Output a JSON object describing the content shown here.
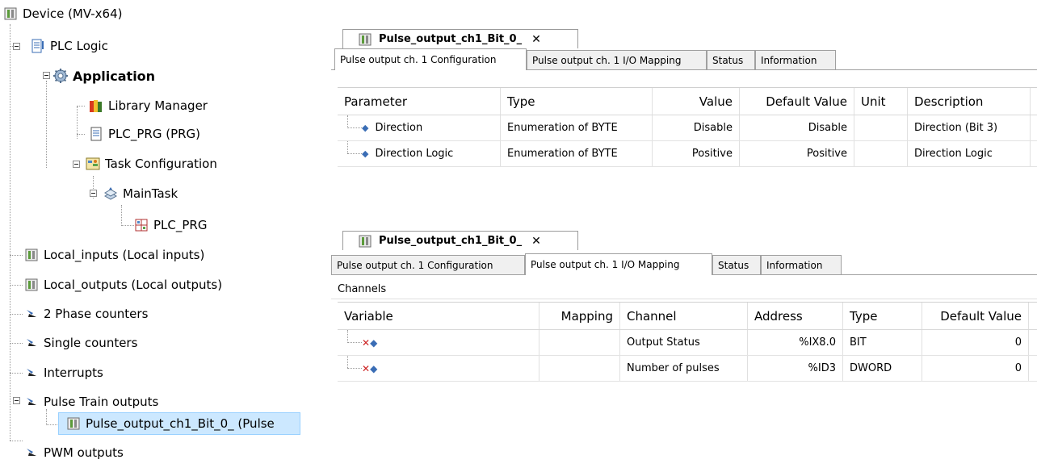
{
  "tree": {
    "device": "Device (MV-x64)",
    "plc_logic": "PLC Logic",
    "application": "Application",
    "library_manager": "Library Manager",
    "plc_prg": "PLC_PRG (PRG)",
    "task_configuration": "Task Configuration",
    "main_task": "MainTask",
    "main_task_prg": "PLC_PRG",
    "local_inputs": "Local_inputs (Local inputs)",
    "local_outputs": "Local_outputs (Local outputs)",
    "phase_counters": "2 Phase counters",
    "single_counters": "Single counters",
    "interrupts": "Interrupts",
    "pulse_train_outputs": "Pulse Train outputs",
    "pulse_output_item": "Pulse_output_ch1_Bit_0_ (Pulse",
    "pwm_outputs": "PWM outputs"
  },
  "editor_top": {
    "doc_tab": "Pulse_output_ch1_Bit_0_",
    "close_glyph": "✕",
    "tabs": [
      "Pulse output ch. 1 Configuration",
      "Pulse output ch. 1 I/O Mapping",
      "Status",
      "Information"
    ],
    "active_tab": 0,
    "columns": [
      "Parameter",
      "Type",
      "Value",
      "Default Value",
      "Unit",
      "Description"
    ],
    "rows": [
      {
        "parameter": "Direction",
        "type": "Enumeration of BYTE",
        "value": "Disable",
        "default": "Disable",
        "unit": "",
        "description": "Direction (Bit 3)"
      },
      {
        "parameter": "Direction Logic",
        "type": "Enumeration of BYTE",
        "value": "Positive",
        "default": "Positive",
        "unit": "",
        "description": "Direction Logic"
      }
    ]
  },
  "editor_bottom": {
    "doc_tab": "Pulse_output_ch1_Bit_0_",
    "close_glyph": "✕",
    "tabs": [
      "Pulse output ch. 1 Configuration",
      "Pulse output ch. 1 I/O Mapping",
      "Status",
      "Information"
    ],
    "active_tab": 1,
    "channels_label": "Channels",
    "columns": [
      "Variable",
      "Mapping",
      "Channel",
      "Address",
      "Type",
      "Default Value"
    ],
    "rows": [
      {
        "variable": "",
        "mapping": "",
        "channel": "Output Status",
        "address": "%IX8.0",
        "type": "BIT",
        "default": "0"
      },
      {
        "variable": "",
        "mapping": "",
        "channel": "Number of pulses",
        "address": "%ID3",
        "type": "DWORD",
        "default": "0"
      }
    ]
  },
  "icons": {
    "device": "device-icon",
    "plc_logic": "plc-logic-icon",
    "application": "gear-icon",
    "library": "books-icon",
    "pou": "pou-document-icon",
    "task_config": "task-configuration-icon",
    "task": "task-icon",
    "pou_call": "pou-call-icon",
    "io_module": "io-module-icon",
    "parameter": "parameter-diamond-icon",
    "mapping": "io-mapping-arrow-icon"
  },
  "colors": {
    "selection": "#cce8ff",
    "selection_border": "#99d1ff",
    "tab_border": "#a0a0a0"
  }
}
